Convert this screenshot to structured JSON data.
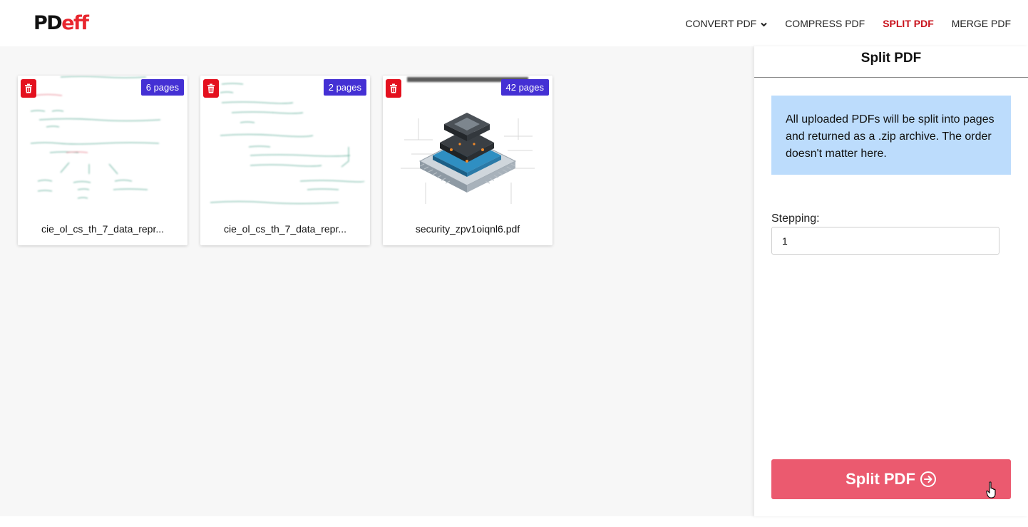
{
  "brand": {
    "logo_primary": "PD",
    "logo_accent": "eff",
    "accent_color": "#e8262e"
  },
  "nav": {
    "items": [
      {
        "label": "CONVERT PDF",
        "has_dropdown": true,
        "active": false
      },
      {
        "label": "COMPRESS PDF",
        "active": false
      },
      {
        "label": "SPLIT PDF",
        "active": true
      },
      {
        "label": "MERGE PDF",
        "active": false
      }
    ]
  },
  "files": [
    {
      "name": "cie_ol_cs_th_7_data_repr...",
      "pages": "6 pages",
      "thumbnail": "handwritten-notes"
    },
    {
      "name": "cie_ol_cs_th_7_data_repr...",
      "pages": "2 pages",
      "thumbnail": "handwritten-notes"
    },
    {
      "name": "security_zpv1oiqnl6.pdf",
      "pages": "42 pages",
      "thumbnail": "chip-illustration"
    }
  ],
  "panel": {
    "title": "Split PDF",
    "info": "All uploaded PDFs will be split into pages and returned as a .zip archive. The order doesn't matter here.",
    "stepping_label": "Stepping:",
    "stepping_value": "1",
    "submit_label": "Split PDF"
  },
  "colors": {
    "badge": "#4430d4",
    "delete": "#e4101e",
    "info_bg": "#bcdcfc",
    "button": "#eb5a6f",
    "active_nav": "#c8101a"
  }
}
